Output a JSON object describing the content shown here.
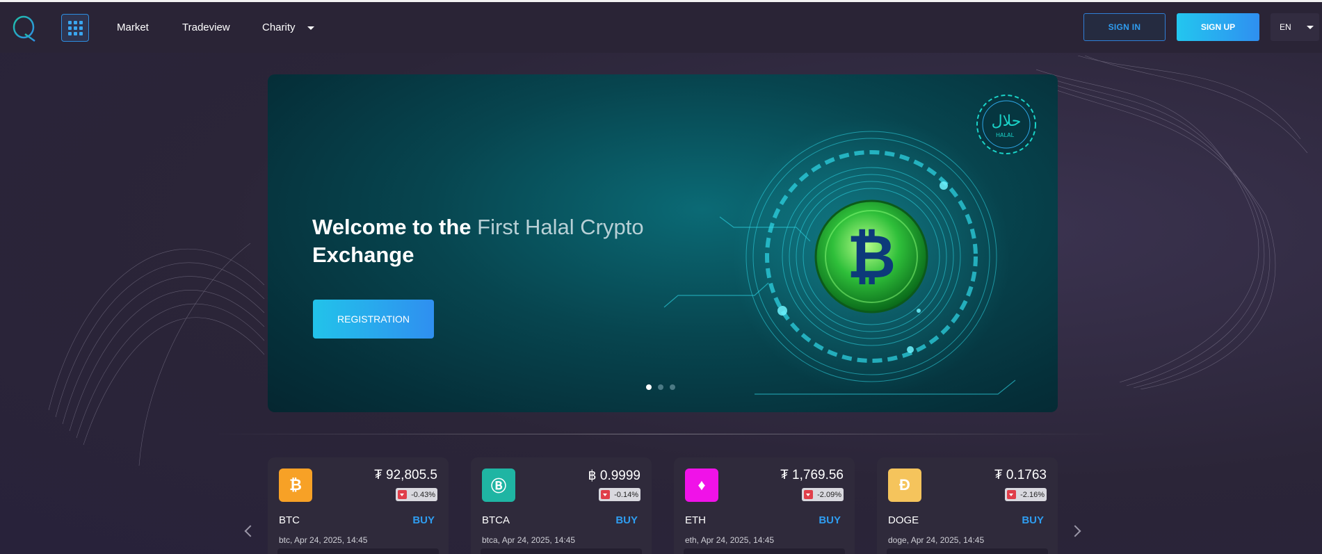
{
  "nav": {
    "links": [
      "Market",
      "Tradeview",
      "Charity"
    ],
    "signin": "SIGN IN",
    "signup": "SIGN UP",
    "lang": "EN"
  },
  "hero": {
    "title_part1": "Welcome to the ",
    "title_part2": "First Halal Crypto",
    "title_part3": "Exchange",
    "button": "REGISTRATION",
    "slides": 3,
    "active_slide": 1,
    "badge_text": "HALAL"
  },
  "tickers": [
    {
      "symbol": "BTC",
      "price": "₮ 92,805.5",
      "change": "-0.43%",
      "buy": "BUY",
      "stamp": "btc, Apr 24, 2025, 14:45",
      "icon": "bitcoin-icon",
      "icon_glyph": "₿",
      "color": "#f7a126"
    },
    {
      "symbol": "BTCA",
      "price": "฿ 0.9999",
      "change": "-0.14%",
      "buy": "BUY",
      "stamp": "btca, Apr 24, 2025, 14:45",
      "icon": "btca-icon",
      "icon_glyph": "Ⓑ",
      "color": "#1fb5a3"
    },
    {
      "symbol": "ETH",
      "price": "₮ 1,769.56",
      "change": "-2.09%",
      "buy": "BUY",
      "stamp": "eth, Apr 24, 2025, 14:45",
      "icon": "ethereum-icon",
      "icon_glyph": "♦",
      "color": "#f012e8"
    },
    {
      "symbol": "DOGE",
      "price": "₮ 0.1763",
      "change": "-2.16%",
      "buy": "BUY",
      "stamp": "doge, Apr 24, 2025, 14:45",
      "icon": "dogecoin-icon",
      "icon_glyph": "Đ",
      "color": "#f5c45c"
    }
  ]
}
